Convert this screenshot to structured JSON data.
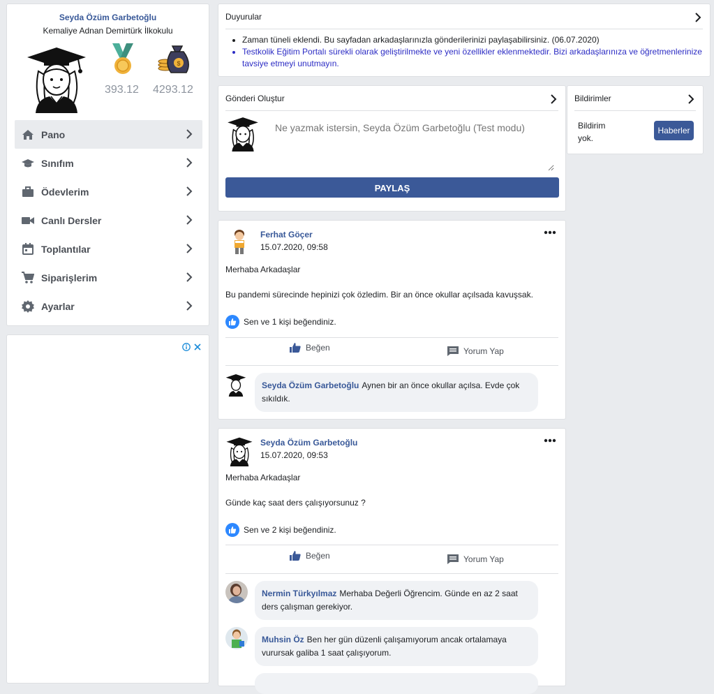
{
  "profile": {
    "name": "Seyda Özüm Garbetoğlu",
    "school": "Kemaliye Adnan Demirtürk İlkokulu",
    "stat1": "393.12",
    "stat2": "4293.12",
    "stat1_icon": "medal-icon",
    "stat2_icon": "money-bag-icon"
  },
  "menu": [
    {
      "label": "Pano",
      "icon": "home-icon",
      "active": true
    },
    {
      "label": "Sınıfım",
      "icon": "graduation-cap-icon"
    },
    {
      "label": "Ödevlerim",
      "icon": "briefcase-icon"
    },
    {
      "label": "Canlı Dersler",
      "icon": "video-camera-icon"
    },
    {
      "label": "Toplantılar",
      "icon": "calendar-icon"
    },
    {
      "label": "Siparişlerim",
      "icon": "shopping-cart-icon"
    },
    {
      "label": "Ayarlar",
      "icon": "gear-icon"
    }
  ],
  "announcements": {
    "title": "Duyurular",
    "items": [
      "Zaman tüneli eklendi. Bu sayfadan arkadaşlarınızla gönderilerinizi paylaşabilirsiniz. (06.07.2020)",
      "Testkolik Eğitim Portalı sürekli olarak geliştirilmekte ve yeni özellikler eklenmektedir. Bizi arkadaşlarınıza ve öğretmenlerinize tavsiye etmeyi unutmayın."
    ]
  },
  "compose": {
    "title": "Gönderi Oluştur",
    "placeholder": "Ne yazmak istersin, Seyda Özüm Garbetoğlu (Test modu)",
    "share_label": "PAYLAŞ"
  },
  "notifications": {
    "title": "Bildirimler",
    "empty_text": "Bildirim yok.",
    "news_button": "Haberler"
  },
  "posts": [
    {
      "author": "Ferhat Göçer",
      "date": "15.07.2020, 09:58",
      "line1": "Merhaba Arkadaşlar",
      "line2": "Bu pandemi sürecinde hepinizi çok özledim. Bir an önce okullar açılsada kavuşsak.",
      "likes": "Sen ve 1 kişi beğendiniz.",
      "like_label": "Beğen",
      "comment_label": "Yorum Yap",
      "comments": [
        {
          "author": "Seyda Özüm Garbetoğlu",
          "text": "Aynen bir an önce okullar açılsa. Evde çok sıkıldık."
        }
      ]
    },
    {
      "author": "Seyda Özüm Garbetoğlu",
      "date": "15.07.2020, 09:53",
      "line1": "Merhaba Arkadaşlar",
      "line2": "Günde kaç saat ders çalışıyorsunuz ?",
      "likes": "Sen ve 2 kişi beğendiniz.",
      "like_label": "Beğen",
      "comment_label": "Yorum Yap",
      "comments": [
        {
          "author": "Nermin Türkyılmaz",
          "text": "Merhaba Değerli Öğrencim. Günde en az 2 saat ders çalışman gerekiyor."
        },
        {
          "author": "Muhsin Öz",
          "text": "Ben her gün düzenli çalışamıyorum ancak ortalamaya vurursak galiba 1 saat çalışıyorum."
        }
      ]
    }
  ],
  "colors": {
    "brand": "#3b5998",
    "link": "#385898",
    "background": "#e9ebee",
    "like": "#2d88ff"
  }
}
